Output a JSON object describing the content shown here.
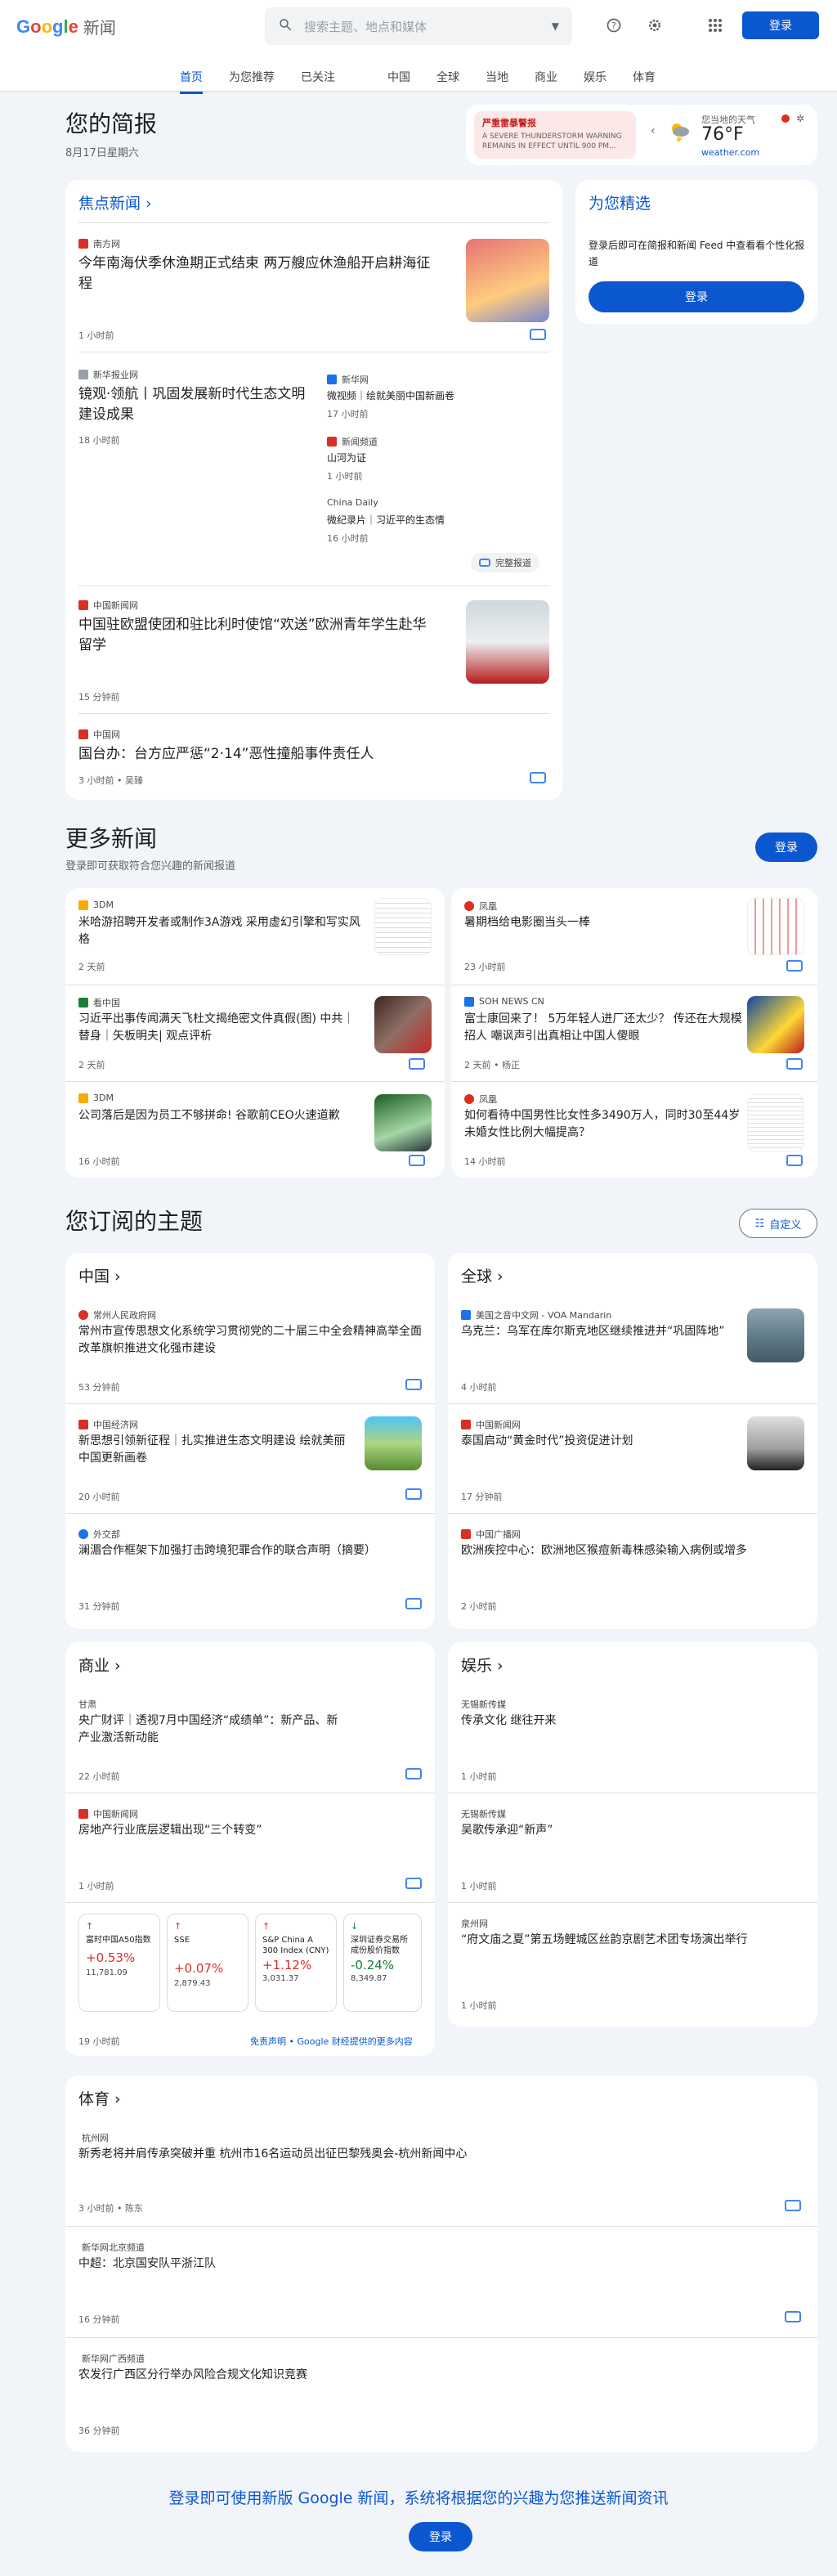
{
  "header": {
    "logo": [
      "G",
      "o",
      "o",
      "g",
      "l",
      "e"
    ],
    "logo_suffix": "新闻",
    "search_placeholder": "搜索主题、地点和媒体",
    "login": "登录"
  },
  "nav": [
    "首页",
    "为您推荐",
    "已关注",
    "中国",
    "全球",
    "当地",
    "商业",
    "娱乐",
    "体育"
  ],
  "briefing": {
    "title": "您的简报",
    "date": "8月17日星期六",
    "alert_title": "严重雷暴警报",
    "alert_text": "A SEVERE THUNDERSTORM WARNING REMAINS IN EFFECT UNTIL 900 PM...",
    "weather_label": "您当地的天气",
    "temp": "76°F",
    "weather_source": "weather.com"
  },
  "top": {
    "title": "焦点新闻",
    "stories": [
      {
        "source": "南方网",
        "title": "今年南海伏季休渔期正式结束 两万艘应休渔船开启耕海征程",
        "time": "1 小时前"
      },
      {
        "source": "新华报业网",
        "title": "镜观·领航丨巩固发展新时代生态文明建设成果",
        "time": "18 小时前"
      },
      {
        "source": "新华网",
        "title": "微视频｜绘就美丽中国新画卷",
        "time": "17 小时前"
      },
      {
        "source": "新闻频道",
        "title": "山河为证",
        "time": "1 小时前"
      },
      {
        "source": "China Daily",
        "title": "微纪录片｜习近平的生态情",
        "time": "16 小时前"
      },
      {
        "source": "中国新闻网",
        "title": "中国驻欧盟使团和驻比利时使馆“欢送”欧洲青年学生赴华留学",
        "time": "15 分钟前"
      },
      {
        "source": "中国网",
        "title": "国台办：台方应严惩“2·14”恶性撞船事件责任人",
        "time": "3 小时前 • 吴臻"
      }
    ],
    "full_coverage": "完整报道"
  },
  "for_you": {
    "title": "为您精选",
    "text": "登录后即可在简报和新闻 Feed 中查看看个性化报道",
    "login": "登录"
  },
  "more": {
    "title": "更多新闻",
    "sub": "登录即可获取符合您兴趣的新闻报道",
    "login": "登录",
    "stories": [
      {
        "source": "3DM",
        "title": "米哈游招聘开发者或制作3A游戏 采用虚幻引擎和写实风格",
        "time": "2 天前"
      },
      {
        "source": "凤凰",
        "title": "暑期档给电影圈当头一棒",
        "time": "23 小时前"
      },
      {
        "source": "看中国",
        "title": "习近平出事传闻满天飞杜文揭绝密文件真假(图) 中共｜替身｜矢板明夫| 观点评析",
        "time": "2 天前"
      },
      {
        "source": "SOH NEWS CN",
        "title": "富士康回来了！ 5万年轻人进厂还太少？ 传还在大规模招人 嘲讽声引出真相让中国人傻眼",
        "time": "2 天前 • 杨正"
      },
      {
        "source": "3DM",
        "title": "公司落后是因为员工不够拼命! 谷歌前CEO火速道歉",
        "time": "16 小时前"
      },
      {
        "source": "凤凰",
        "title": "如何看待中国男性比女性多3490万人，同时30至44岁未婚女性比例大幅提高？",
        "time": "14 小时前"
      }
    ]
  },
  "topics": {
    "title": "您订阅的主题",
    "customize": "自定义",
    "china": {
      "title": "中国",
      "stories": [
        {
          "source": "常州人民政府网",
          "title": "常州市宣传思想文化系统学习贯彻党的二十届三中全会精神高举全面改革旗帜推进文化强市建设",
          "time": "53 分钟前"
        },
        {
          "source": "中国经济网",
          "title": "新思想引领新征程｜扎实推进生态文明建设 绘就美丽中国更新画卷",
          "time": "20 小时前"
        },
        {
          "source": "外交部",
          "title": "澜湄合作框架下加强打击跨境犯罪合作的联合声明（摘要）",
          "time": "31 分钟前"
        }
      ]
    },
    "world": {
      "title": "全球",
      "stories": [
        {
          "source": "美国之音中文网 - VOA Mandarin",
          "title": "乌克兰：乌军在库尔斯克地区继续推进并“巩固阵地”",
          "time": "4 小时前"
        },
        {
          "source": "中国新闻网",
          "title": "泰国启动“黄金时代”投资促进计划",
          "time": "17 分钟前"
        },
        {
          "source": "中国广播网",
          "title": "欧洲疾控中心：欧洲地区猴痘新毒株感染输入病例或增多",
          "time": "2 小时前"
        }
      ]
    },
    "business": {
      "title": "商业",
      "stories": [
        {
          "source": "甘肃",
          "title": "央广财评｜透视7月中国经济“成绩单”：新产品、新产业激活新动能",
          "time": "22 小时前"
        },
        {
          "source": "中国新闻网",
          "title": "房地产行业底层逻辑出现“三个转变”",
          "time": "1 小时前"
        }
      ],
      "stocks": [
        {
          "name": "富时中国A50指数",
          "change": "+0.53%",
          "value": "11,781.09",
          "dir": "up"
        },
        {
          "name": "SSE",
          "change": "+0.07%",
          "value": "2,879.43",
          "dir": "up"
        },
        {
          "name": "S&P China A 300 Index (CNY)",
          "change": "+1.12%",
          "value": "3,031.37",
          "dir": "up"
        },
        {
          "name": "深圳证券交易所成份股价指数",
          "change": "-0.24%",
          "value": "8,349.87",
          "dir": "down"
        }
      ],
      "stock_time": "19 小时前",
      "disclaimer": "免责声明 • Google 财经提供的更多内容"
    },
    "ent": {
      "title": "娱乐",
      "stories": [
        {
          "source": "无锡新传媒",
          "title": "传承文化 继往开来",
          "time": "1 小时前"
        },
        {
          "source": "无锡新传媒",
          "title": "吴歌传承迎“新声”",
          "time": "1 小时前"
        },
        {
          "source": "泉州网",
          "title": "“府文庙之夏”第五场鲤城区丝韵京剧艺术团专场演出举行",
          "time": "1 小时前"
        }
      ]
    },
    "sports": {
      "title": "体育",
      "stories": [
        {
          "source": "杭州网",
          "title": "新秀老将并肩传承突破并重 杭州市16名运动员出征巴黎残奥会-杭州新闻中心",
          "time": "3 小时前 • 陈东"
        },
        {
          "source": "新华网北京频道",
          "title": "中超：北京国安队平浙江队",
          "time": "16 分钟前"
        },
        {
          "source": "新华网广西频道",
          "title": "农发行广西区分行举办风险合规文化知识竞赛",
          "time": "36 分钟前"
        }
      ]
    }
  },
  "footer": {
    "text": "登录即可使用新版 Google 新闻，系统将根据您的兴趣为您推送新闻资讯",
    "login": "登录"
  },
  "colors": {
    "accent": "#0b57d0",
    "up": "#d93025",
    "down": "#188038"
  }
}
